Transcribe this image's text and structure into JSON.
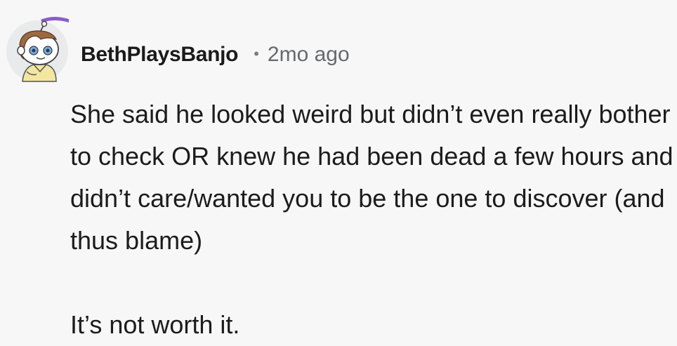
{
  "comment": {
    "author": "BethPlaysBanjo",
    "separator": "•",
    "timestamp": "2mo ago",
    "avatar_icon": "snoo-avatar-icon",
    "paragraphs": [
      "She said he looked weird but didn’t even really bother to check OR knew he had been dead a few hours and didn’t care/wanted you to be the one to discover (and thus blame)",
      "It’s not worth it."
    ]
  },
  "colors": {
    "background": "#f7f7f8",
    "text": "#1c1c1c",
    "meta_text": "#666a6e",
    "avatar_hat": "#8a5cc8"
  }
}
